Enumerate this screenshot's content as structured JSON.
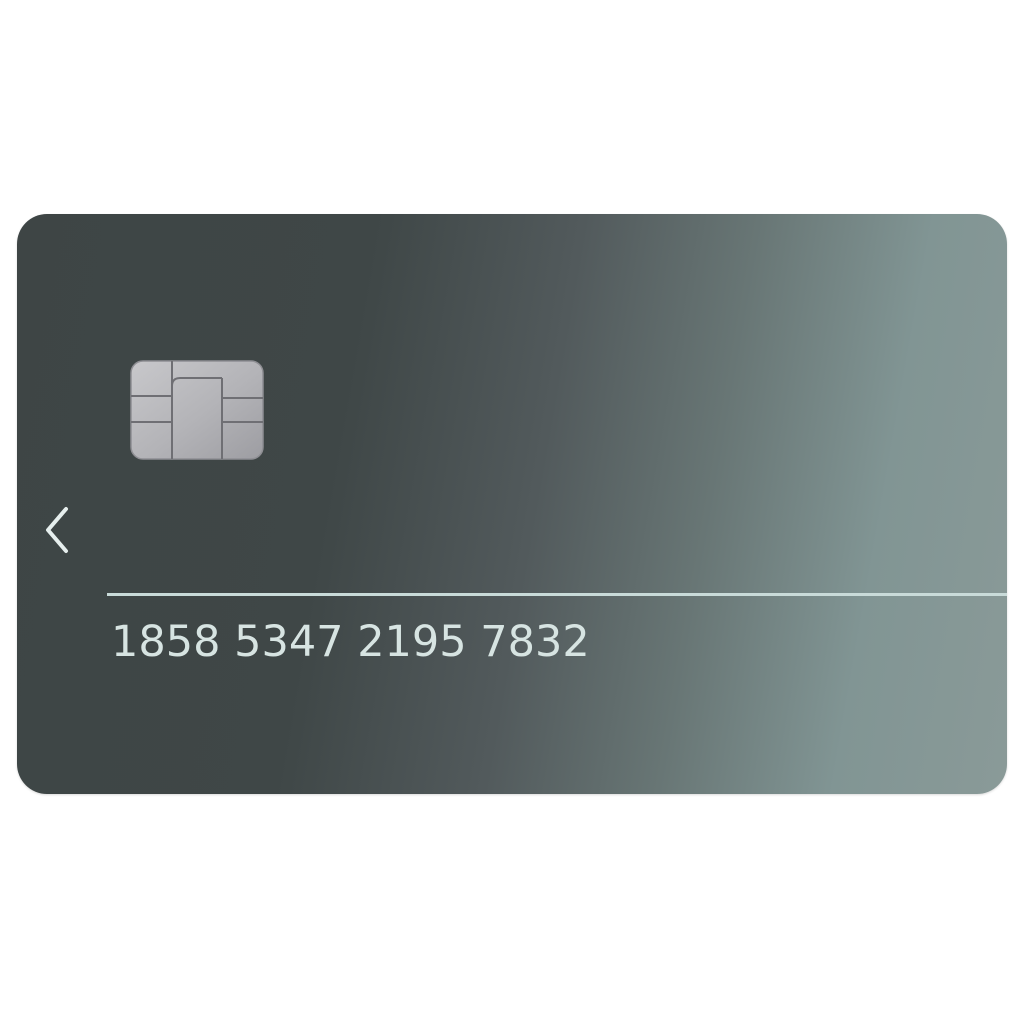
{
  "card": {
    "number": "1858 5347 2195 7832",
    "chip_icon": "emv-chip-icon",
    "prev_icon": "chevron-left-icon",
    "colors": {
      "gradient_dark": "#3e4545",
      "gradient_light": "#8a9a98",
      "divider": "#c9dbd9",
      "text": "#d7e4e2",
      "chip": "#b5b5b9"
    }
  }
}
